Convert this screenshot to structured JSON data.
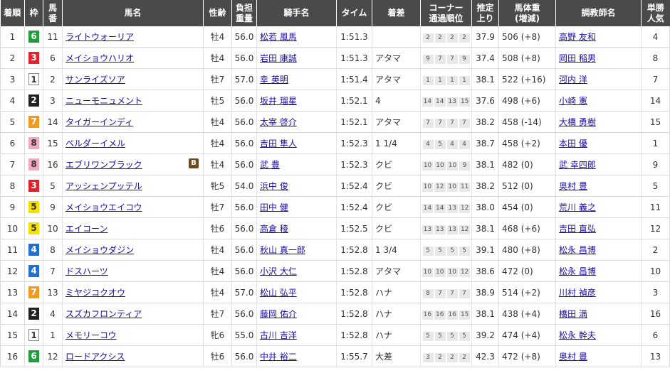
{
  "headers": {
    "rank": "着順",
    "waku": "枠",
    "umaban_top": "馬",
    "umaban_bottom": "番",
    "horse": "馬名",
    "sexage": "性齢",
    "weight_top": "負担",
    "weight_bottom": "重量",
    "jockey": "騎手名",
    "time": "タイム",
    "margin": "着差",
    "corner_top": "コーナー",
    "corner_bottom": "通過順位",
    "final3f_top": "推定",
    "final3f_bottom": "上り",
    "body_top": "馬体重",
    "body_bottom": "(増減)",
    "trainer": "調教師名",
    "pop_top": "単勝",
    "pop_bottom": "人気"
  },
  "rows": [
    {
      "rank": "1",
      "waku": "6",
      "wakuclass": "w6",
      "num": "11",
      "horse": "ライトウォーリア",
      "badge": "",
      "sexage": "牡4",
      "weight": "56.0",
      "jockey": "松若 風馬",
      "time": "1:51.3",
      "margin": "",
      "c1": "2",
      "c2": "2",
      "c3": "2",
      "c4": "2",
      "f3": "37.9",
      "body": "506 (+8)",
      "trainer": "高野 友和",
      "pop": "4"
    },
    {
      "rank": "2",
      "waku": "3",
      "wakuclass": "w3",
      "num": "6",
      "horse": "メイショウハリオ",
      "badge": "",
      "sexage": "牡4",
      "weight": "56.0",
      "jockey": "岩田 康誠",
      "time": "1:51.3",
      "margin": "アタマ",
      "c1": "9",
      "c2": "7",
      "c3": "7",
      "c4": "9",
      "f3": "37.4",
      "body": "508 (+8)",
      "trainer": "岡田 稲男",
      "pop": "8"
    },
    {
      "rank": "3",
      "waku": "1",
      "wakuclass": "w1",
      "num": "2",
      "horse": "サンライズソア",
      "badge": "",
      "sexage": "牡7",
      "weight": "57.0",
      "jockey": "幸 英明",
      "time": "1:51.4",
      "margin": "アタマ",
      "c1": "1",
      "c2": "1",
      "c3": "1",
      "c4": "1",
      "f3": "38.1",
      "body": "522 (+16)",
      "trainer": "河内 洋",
      "pop": "7"
    },
    {
      "rank": "4",
      "waku": "2",
      "wakuclass": "w2",
      "num": "3",
      "horse": "ニューモニュメント",
      "badge": "",
      "sexage": "牡5",
      "weight": "56.0",
      "jockey": "坂井 瑠星",
      "time": "1:52.1",
      "margin": "4",
      "c1": "14",
      "c2": "14",
      "c3": "13",
      "c4": "15",
      "f3": "37.6",
      "body": "498 (+6)",
      "trainer": "小崎 憲",
      "pop": "14"
    },
    {
      "rank": "5",
      "waku": "7",
      "wakuclass": "w7",
      "num": "14",
      "horse": "タイガーインディ",
      "badge": "",
      "sexage": "牡4",
      "weight": "56.0",
      "jockey": "太宰 啓介",
      "time": "1:52.1",
      "margin": "アタマ",
      "c1": "7",
      "c2": "7",
      "c3": "7",
      "c4": "7",
      "f3": "38.2",
      "body": "458 (-14)",
      "trainer": "大橋 勇樹",
      "pop": "15"
    },
    {
      "rank": "6",
      "waku": "8",
      "wakuclass": "w8",
      "num": "15",
      "horse": "ベルダーイメル",
      "badge": "",
      "sexage": "牡4",
      "weight": "56.0",
      "jockey": "吉田 隼人",
      "time": "1:52.3",
      "margin": "1 1/4",
      "c1": "4",
      "c2": "5",
      "c3": "4",
      "c4": "4",
      "f3": "38.7",
      "body": "458 (+2)",
      "trainer": "本田 優",
      "pop": "1"
    },
    {
      "rank": "7",
      "waku": "8",
      "wakuclass": "w8",
      "num": "16",
      "horse": "エブリワンブラック",
      "badge": "B",
      "sexage": "牡4",
      "weight": "56.0",
      "jockey": "武 豊",
      "time": "1:52.3",
      "margin": "クビ",
      "c1": "10",
      "c2": "10",
      "c3": "10",
      "c4": "9",
      "f3": "38.1",
      "body": "482 (0)",
      "trainer": "武 幸四郎",
      "pop": "9"
    },
    {
      "rank": "8",
      "waku": "3",
      "wakuclass": "w3",
      "num": "5",
      "horse": "アッシェンプッテル",
      "badge": "",
      "sexage": "牝5",
      "weight": "54.0",
      "jockey": "浜中 俊",
      "time": "1:52.4",
      "margin": "クビ",
      "c1": "10",
      "c2": "12",
      "c3": "10",
      "c4": "11",
      "f3": "38.2",
      "body": "512 (0)",
      "trainer": "奥村 豊",
      "pop": "5"
    },
    {
      "rank": "9",
      "waku": "5",
      "wakuclass": "w5",
      "num": "9",
      "horse": "メイショウエイコウ",
      "badge": "",
      "sexage": "牡7",
      "weight": "56.0",
      "jockey": "田中 健",
      "time": "1:52.4",
      "margin": "クビ",
      "c1": "14",
      "c2": "14",
      "c3": "13",
      "c4": "12",
      "f3": "38.0",
      "body": "454 (0)",
      "trainer": "荒川 義之",
      "pop": "11"
    },
    {
      "rank": "10",
      "waku": "5",
      "wakuclass": "w5",
      "num": "10",
      "horse": "エイコーン",
      "badge": "",
      "sexage": "牡6",
      "weight": "56.0",
      "jockey": "高倉 稜",
      "time": "1:52.5",
      "margin": "クビ",
      "c1": "13",
      "c2": "13",
      "c3": "13",
      "c4": "12",
      "f3": "38.1",
      "body": "468 (+6)",
      "trainer": "吉田 直弘",
      "pop": "12"
    },
    {
      "rank": "11",
      "waku": "4",
      "wakuclass": "w4",
      "num": "8",
      "horse": "メイショウダジン",
      "badge": "",
      "sexage": "牡4",
      "weight": "56.0",
      "jockey": "秋山 真一郎",
      "time": "1:52.8",
      "margin": "1 3/4",
      "c1": "5",
      "c2": "5",
      "c3": "5",
      "c4": "5",
      "f3": "39.1",
      "body": "480 (+8)",
      "trainer": "松永 昌博",
      "pop": "2"
    },
    {
      "rank": "12",
      "waku": "4",
      "wakuclass": "w4",
      "num": "7",
      "horse": "ドスハーツ",
      "badge": "",
      "sexage": "牡4",
      "weight": "56.0",
      "jockey": "小沢 大仁",
      "time": "1:52.8",
      "margin": "アタマ",
      "c1": "10",
      "c2": "10",
      "c3": "10",
      "c4": "12",
      "f3": "38.6",
      "body": "472 (0)",
      "trainer": "松永 昌博",
      "pop": "10"
    },
    {
      "rank": "13",
      "waku": "7",
      "wakuclass": "w7",
      "num": "13",
      "horse": "ミヤジコクオウ",
      "badge": "",
      "sexage": "牡4",
      "weight": "57.0",
      "jockey": "松山 弘平",
      "time": "1:52.8",
      "margin": "ハナ",
      "c1": "8",
      "c2": "7",
      "c3": "7",
      "c4": "7",
      "f3": "38.9",
      "body": "514 (+2)",
      "trainer": "川村 禎彦",
      "pop": "3"
    },
    {
      "rank": "14",
      "waku": "2",
      "wakuclass": "w2",
      "num": "4",
      "horse": "スズカフロンティア",
      "badge": "",
      "sexage": "牡7",
      "weight": "56.0",
      "jockey": "藤岡 佑介",
      "time": "1:52.8",
      "margin": "ハナ",
      "c1": "16",
      "c2": "16",
      "c3": "16",
      "c4": "15",
      "f3": "38.1",
      "body": "438 (+4)",
      "trainer": "橋田 満",
      "pop": "16"
    },
    {
      "rank": "15",
      "waku": "1",
      "wakuclass": "w1",
      "num": "1",
      "horse": "メモリーコウ",
      "badge": "",
      "sexage": "牝6",
      "weight": "55.0",
      "jockey": "古川 吉洋",
      "time": "1:52.8",
      "margin": "ハナ",
      "c1": "5",
      "c2": "5",
      "c3": "5",
      "c4": "5",
      "f3": "39.2",
      "body": "474 (+4)",
      "trainer": "松永 幹夫",
      "pop": "6"
    },
    {
      "rank": "16",
      "waku": "6",
      "wakuclass": "w6",
      "num": "12",
      "horse": "ロードアクシス",
      "badge": "",
      "sexage": "牡6",
      "weight": "56.0",
      "jockey": "中井 裕二",
      "time": "1:55.7",
      "margin": "大差",
      "c1": "3",
      "c2": "2",
      "c3": "2",
      "c4": "2",
      "f3": "42.3",
      "body": "472 (+8)",
      "trainer": "奥村 豊",
      "pop": "13"
    }
  ]
}
